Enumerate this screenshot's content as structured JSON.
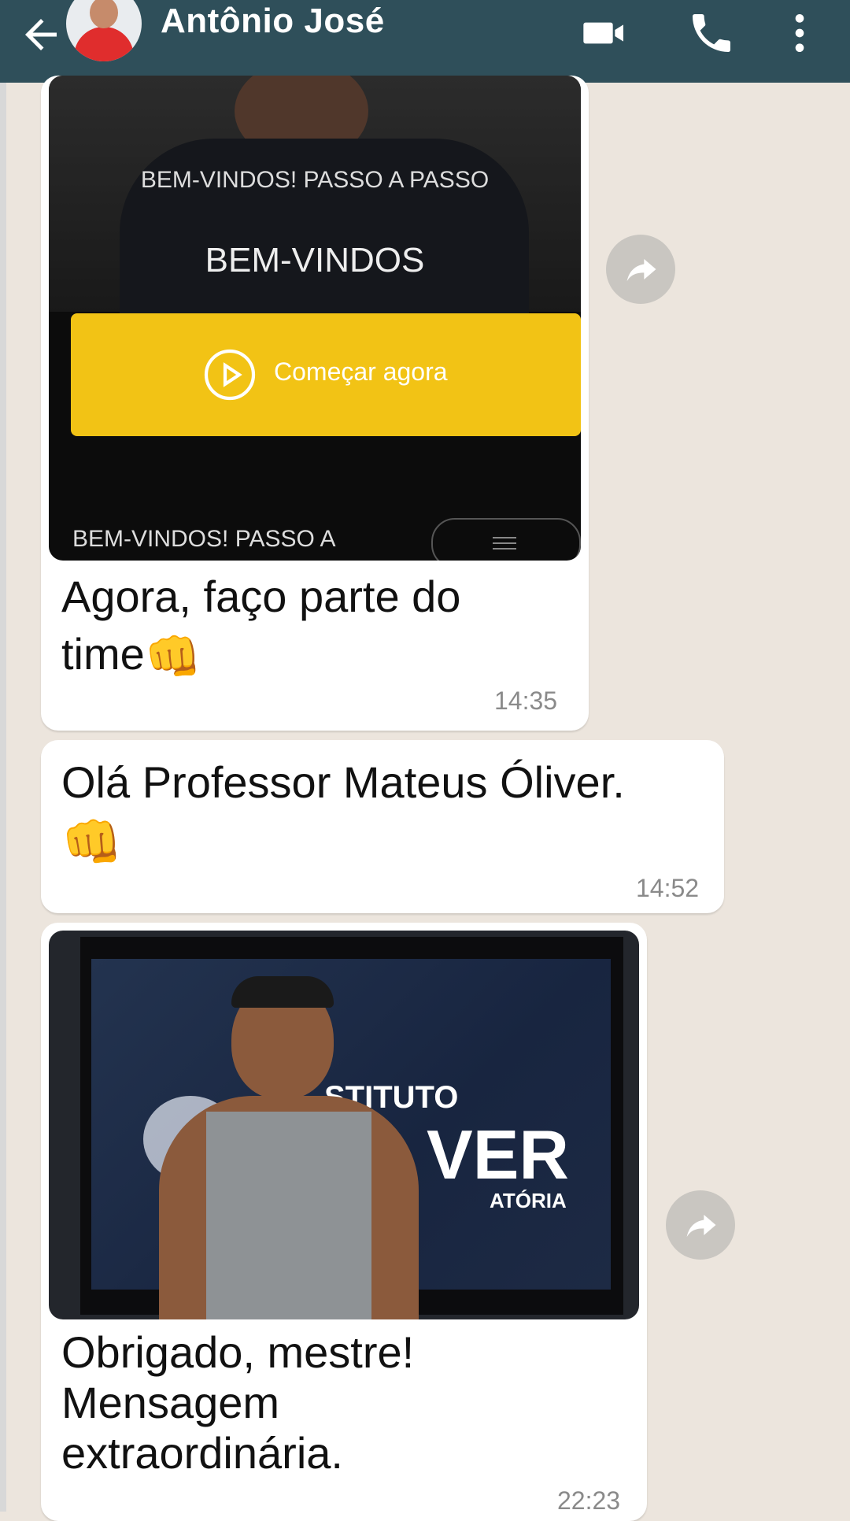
{
  "header": {
    "contact_name": "Antônio José",
    "icons": [
      "back-arrow-icon",
      "video-call-icon",
      "phone-icon",
      "more-vert-icon"
    ]
  },
  "messages": [
    {
      "media": {
        "overlay_top": "BEM-VINDOS! PASSO A PASSO",
        "overlay_title": "BEM-VINDOS",
        "button_label": "Começar agora",
        "bottom_caption": "BEM-VINDOS! PASSO A"
      },
      "text_line1": "Agora, faço parte do",
      "text_line2": "time",
      "time": "14:35"
    },
    {
      "text_line1": "Olá Professor Mateus Óliver.",
      "time": "14:52"
    },
    {
      "media": {
        "sign_line1": "STITUTO",
        "sign_line2": "VER",
        "sign_line3": "ATÓRIA"
      },
      "text_line1": "Obrigado, mestre!",
      "text_line2": "Mensagem",
      "text_line3": "extraordinária.",
      "time": "22:23"
    }
  ],
  "colors": {
    "header": "#2f4f5a",
    "wallpaper": "#ece5dd",
    "bubble": "#ffffff",
    "cta_button": "#f2c315"
  }
}
